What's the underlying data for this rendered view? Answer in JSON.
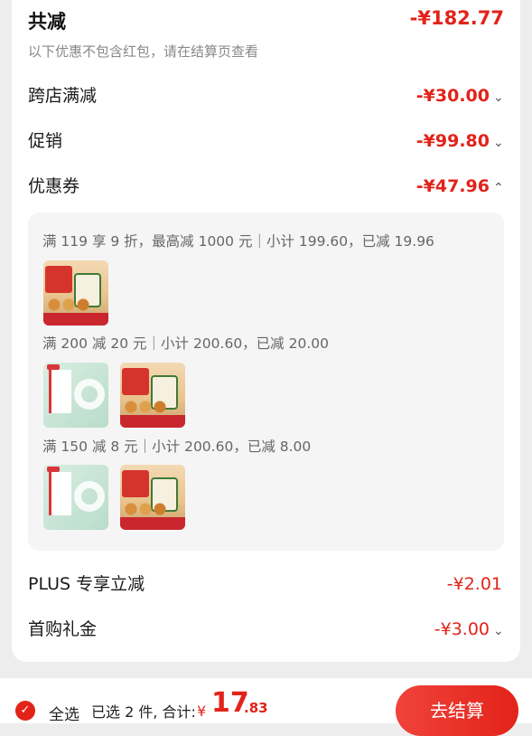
{
  "summary": {
    "title": "共减",
    "total": "-¥182.77",
    "note": "以下优惠不包含红包，请在结算页查看"
  },
  "rows": [
    {
      "label": "跨店满减",
      "amount": "-¥30.00",
      "chevron": "⌄"
    },
    {
      "label": "促销",
      "amount": "-¥99.80",
      "chevron": "⌄"
    },
    {
      "label": "优惠券",
      "amount": "-¥47.96",
      "chevron": "⌃"
    }
  ],
  "coupon_rules": [
    {
      "text": "满 119 享 9 折，最高减 1000 元｜小计 199.60，已减 19.96",
      "items": [
        "food-product-image"
      ]
    },
    {
      "text": "满 200 减 20 元｜小计 200.60，已减 20.00",
      "items": [
        "tape-product-image",
        "food-product-image"
      ]
    },
    {
      "text": "满 150 减 8 元｜小计 200.60，已减 8.00",
      "items": [
        "tape-product-image",
        "food-product-image"
      ]
    }
  ],
  "extra_rows": [
    {
      "label": "PLUS 专享立减",
      "amount": "-¥2.01",
      "chevron": ""
    },
    {
      "label": "首购礼金",
      "amount": "-¥3.00",
      "chevron": "⌄"
    }
  ],
  "footer": {
    "select_all": "全选",
    "selected": "已选 2 件, 合计:",
    "currency": "¥",
    "total_int": "17",
    "total_dec": ".83",
    "checkout": "去结算"
  },
  "colors": {
    "accent": "#e2231a",
    "muted": "#888888",
    "panel": "#f5f5f5"
  }
}
